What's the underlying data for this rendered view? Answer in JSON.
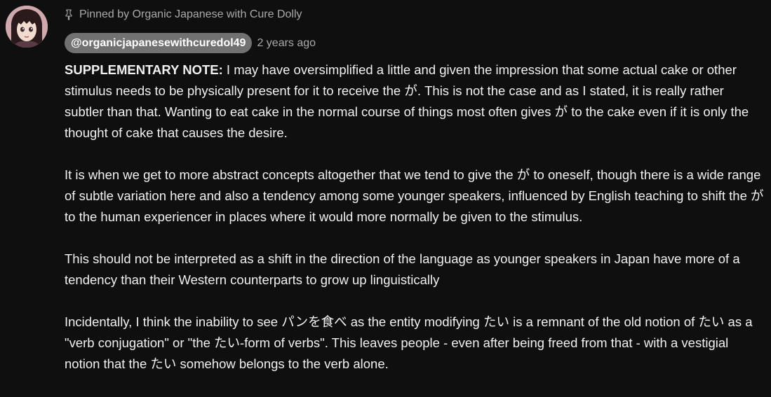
{
  "pinned": {
    "icon": "pin-icon",
    "text": "Pinned by Organic Japanese with Cure Dolly"
  },
  "author": {
    "handle": "@organicjapanesewithcuredol49",
    "avatar_icon": "doll-avatar",
    "chip_color": "#717171"
  },
  "timestamp": "2 years ago",
  "body": {
    "p1_label": "SUPPLEMENTARY NOTE:",
    "p1_text": " I may have oversimplified a little and given the impression that some actual cake or other stimulus needs to be physically present for it to receive the が. This is not the case and as I stated, it is really rather subtler than that. Wanting to eat cake in the normal course of things most often gives が to the cake even if it is only the thought of cake that causes the desire.",
    "p2": "It is when we get to more abstract concepts altogether that we tend to give the が to oneself, though there is a wide range of subtle variation here and also a tendency among some younger speakers, influenced by English teaching to shift the が to the human experiencer in places where it would more normally be given to the stimulus.",
    "p3": "This should not be interpreted as a shift in the direction of the language as younger speakers in Japan have more of a tendency than their Western counterparts to grow up linguistically",
    "p4": "Incidentally, I think the inability to see パンを食べ as the entity modifying たい is a remnant of the old notion of たい as a \"verb conjugation\" or \"the たい-form of verbs\". This leaves people - even after being freed from that - with a vestigial notion that the たい somehow belongs to the verb alone."
  },
  "colors": {
    "background": "#0f0f0f",
    "text": "#f1f1f1",
    "secondary_text": "#aaaaaa"
  }
}
